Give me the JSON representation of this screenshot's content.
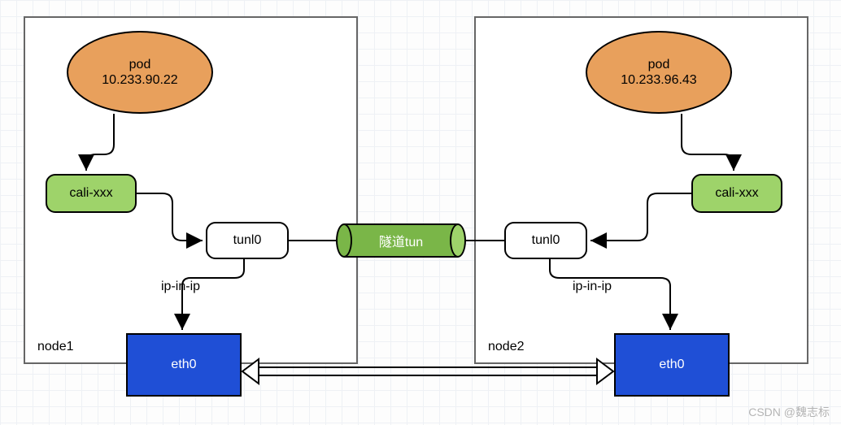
{
  "node1": {
    "label": "node1",
    "pod": {
      "title": "pod",
      "ip": "10.233.90.22"
    },
    "cali": "cali-xxx",
    "tunl": "tunl0",
    "ipinip": "ip-in-ip",
    "eth": "eth0"
  },
  "node2": {
    "label": "node2",
    "pod": {
      "title": "pod",
      "ip": "10.233.96.43"
    },
    "cali": "cali-xxx",
    "tunl": "tunl0",
    "ipinip": "ip-in-ip",
    "eth": "eth0"
  },
  "tunnel": {
    "label": "隧道tun"
  },
  "colors": {
    "pod": "#e8a05c",
    "cali": "#9ed36a",
    "eth": "#1f4fd6",
    "tunnel": "#7ab648"
  },
  "watermark": "CSDN @魏志标"
}
